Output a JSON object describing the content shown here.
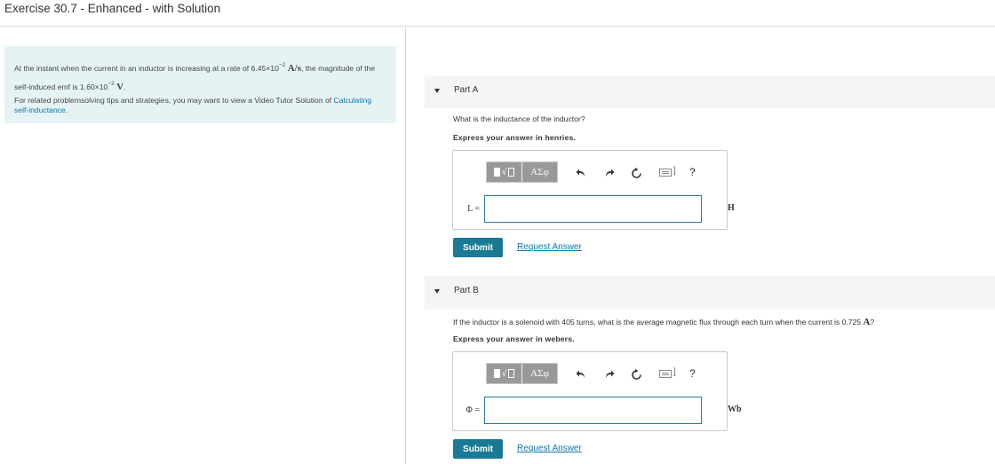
{
  "header": {
    "title": "Exercise 30.7 - Enhanced - with Solution"
  },
  "intro": {
    "p1_pre": "At the instant when the current in an inductor is increasing at a rate of 6.45×10",
    "p1_exp1": "−2",
    "p1_unit1": "A/s",
    "p1_mid": ", the magnitude of the self-induced emf is 1.60×10",
    "p1_exp2": "−2",
    "p1_unit2": "V",
    "p1_end": ".",
    "p2_pre": "For related problemsolving tips and strategies, you may want to view a Video Tutor Solution of ",
    "p2_link": "Calculating self-inductance",
    "p2_end": "."
  },
  "toolbar": {
    "symbols_label": "ΑΣφ",
    "help_label": "?",
    "kbd_bracket": "]"
  },
  "parts": [
    {
      "label": "Part A",
      "question": "What is the inductance of the inductor?",
      "instruction": "Express your answer in henries.",
      "var_label": "L =",
      "input_value": "",
      "unit": "H",
      "submit_label": "Submit",
      "request_label": "Request Answer"
    },
    {
      "label": "Part B",
      "question_pre": "If the inductor is a solenoid with 405 turns, what is the average magnetic flux through each turn when the current is 0.725 ",
      "question_unit": "A",
      "question_end": "?",
      "instruction": "Express your answer in webers.",
      "var_label": "Φ =",
      "input_value": "",
      "unit": "Wb",
      "submit_label": "Submit",
      "request_label": "Request Answer"
    }
  ],
  "colors": {
    "intro_bg": "#e6f3f5",
    "part_header_bg": "#f5f5f5",
    "submit_bg": "#1a7a96",
    "link": "#0a76a8",
    "input_border": "#2c7a8f"
  }
}
